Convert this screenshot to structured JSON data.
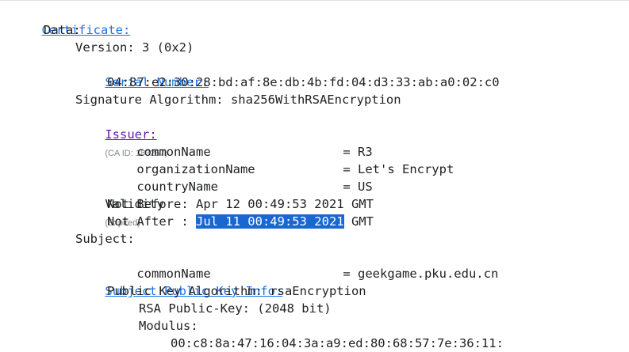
{
  "cert": {
    "certificate_label": "Certificate:",
    "data_label": "Data:",
    "version_text": "Version: 3 (0x2)",
    "serial_label": "Serial Number:",
    "serial_value": "04:87:e2:30:28:bd:af:8e:db:4b:fd:04:d3:33:ab:a0:02:c0",
    "signature_algorithm_text": "Signature Algorithm: sha256WithRSAEncryption",
    "issuer": {
      "label": "Issuer:",
      "note": "(CA ID: 183267)",
      "rows": [
        {
          "name": "commonName",
          "value": "= R3"
        },
        {
          "name": "organizationName",
          "value": "= Let's Encrypt"
        },
        {
          "name": "countryName",
          "value": "= US"
        }
      ]
    },
    "validity": {
      "label": "Validity",
      "note": "(Expired)",
      "not_before_text": "Not Before: Apr 12 00:49:53 2021 GMT",
      "not_after_prefix": "Not After : ",
      "not_after_selected": "Jul 11 00:49:53 2021",
      "not_after_suffix": " GMT"
    },
    "subject": {
      "label": "Subject:",
      "rows": [
        {
          "name": "commonName",
          "value": "= geekgame.pku.edu.cn"
        }
      ]
    },
    "spki": {
      "label": "Subject Public Key Info:",
      "algorithm_text": "Public Key Algorithm: rsaEncryption",
      "rsa_key_text": "RSA Public-Key: (2048 bit)",
      "modulus_label": "Modulus:",
      "modulus_line1": "00:c8:8a:47:16:04:3a:a9:ed:80:68:57:7e:36:11:"
    }
  },
  "colors": {
    "link": "#1a73e8",
    "visited_link": "#681da8",
    "selection_bg": "#1967d2",
    "text": "#202124",
    "note": "#80868b"
  }
}
